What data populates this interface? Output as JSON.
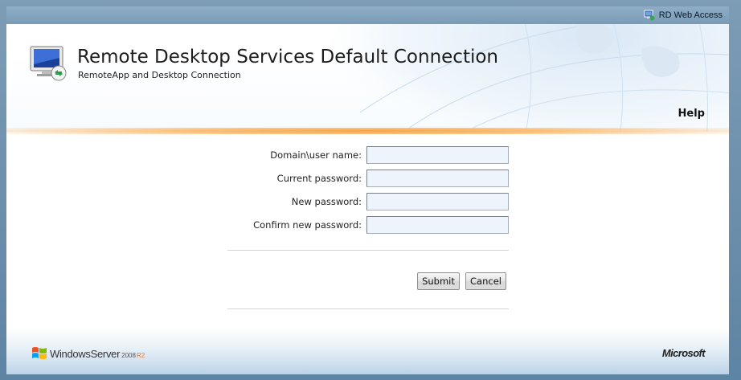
{
  "top_bar": {
    "rd_web_access_label": "RD Web Access",
    "rd_web_access_icon": "rd-web-access-icon"
  },
  "header": {
    "title": "Remote Desktop Services Default Connection",
    "subtitle": "RemoteApp and Desktop Connection",
    "help_label": "Help",
    "app_icon": "remote-computer-icon"
  },
  "form": {
    "fields": [
      {
        "label": "Domain\\user name:",
        "value": ""
      },
      {
        "label": "Current password:",
        "value": ""
      },
      {
        "label": "New password:",
        "value": ""
      },
      {
        "label": "Confirm new password:",
        "value": ""
      }
    ],
    "submit_label": "Submit",
    "cancel_label": "Cancel"
  },
  "footer": {
    "windows_server_text": "WindowsServer",
    "windows_server_version": "2008",
    "windows_server_edition": "R2",
    "microsoft_text": "Microsoft"
  },
  "colors": {
    "accent_orange": "#f7a34a",
    "frame_blue": "#6f91ae",
    "input_fill": "#eef4fb"
  }
}
